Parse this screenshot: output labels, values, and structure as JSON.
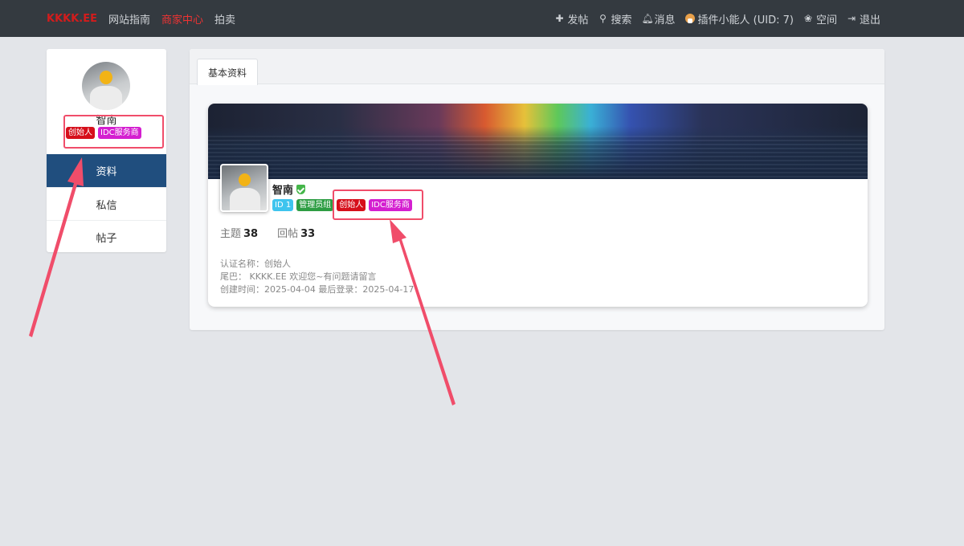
{
  "nav": {
    "logo": "KKKK.EE",
    "links": [
      "网站指南",
      "商家中心",
      "拍卖"
    ],
    "right": {
      "post": "发帖",
      "search": "搜索",
      "messages": "消息",
      "user": "插件小能人 (UID: 7)",
      "space": "空间",
      "logout": "退出"
    }
  },
  "sidebar": {
    "name": "智南",
    "badges": [
      "创始人",
      "IDC服务商"
    ],
    "items": [
      "资料",
      "私信",
      "帖子"
    ],
    "active_index": 0
  },
  "main": {
    "tab": "基本资料",
    "profile": {
      "name": "智南",
      "badges": [
        "ID 1",
        "管理员组",
        "创始人",
        "IDC服务商"
      ],
      "stats": {
        "topics_label": "主题",
        "topics": "38",
        "replies_label": "回帖",
        "replies": "33"
      },
      "info": {
        "cert": "认证名称：创始人",
        "tail": "尾巴： KKKK.EE 欢迎您~有问题请留言",
        "dates": "创建时间：2025-04-04  最后登录：2025-04-17"
      }
    }
  },
  "colors": {
    "nav_bg": "#343a40",
    "active_bg": "#204e7e",
    "badge_red": "#d60f1b",
    "badge_pink": "#d41fd0",
    "badge_cyan": "#3ec4ee",
    "badge_green": "#2d9d43",
    "annotation": "#f04d6a"
  }
}
